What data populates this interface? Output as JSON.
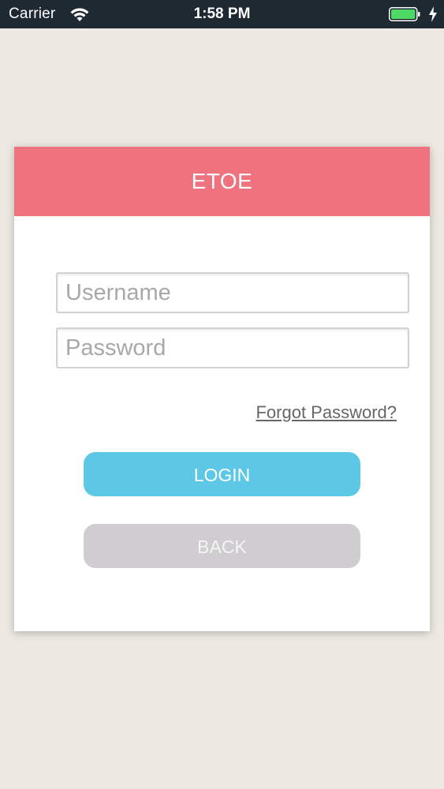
{
  "status_bar": {
    "carrier": "Carrier",
    "time": "1:58 PM",
    "wifi_icon": "wifi-icon",
    "battery_icon": "battery-icon",
    "charging_icon": "bolt-icon",
    "battery_color": "#4cd964"
  },
  "login_card": {
    "title": "ETOE",
    "header_color": "#ee737e",
    "username_placeholder": "Username",
    "username_value": "",
    "password_placeholder": "Password",
    "password_value": "",
    "forgot_password": "Forgot Password?",
    "login_label": "LOGIN",
    "login_color": "#5dc8e6",
    "back_label": "BACK",
    "back_color": "#cfcdcf"
  }
}
